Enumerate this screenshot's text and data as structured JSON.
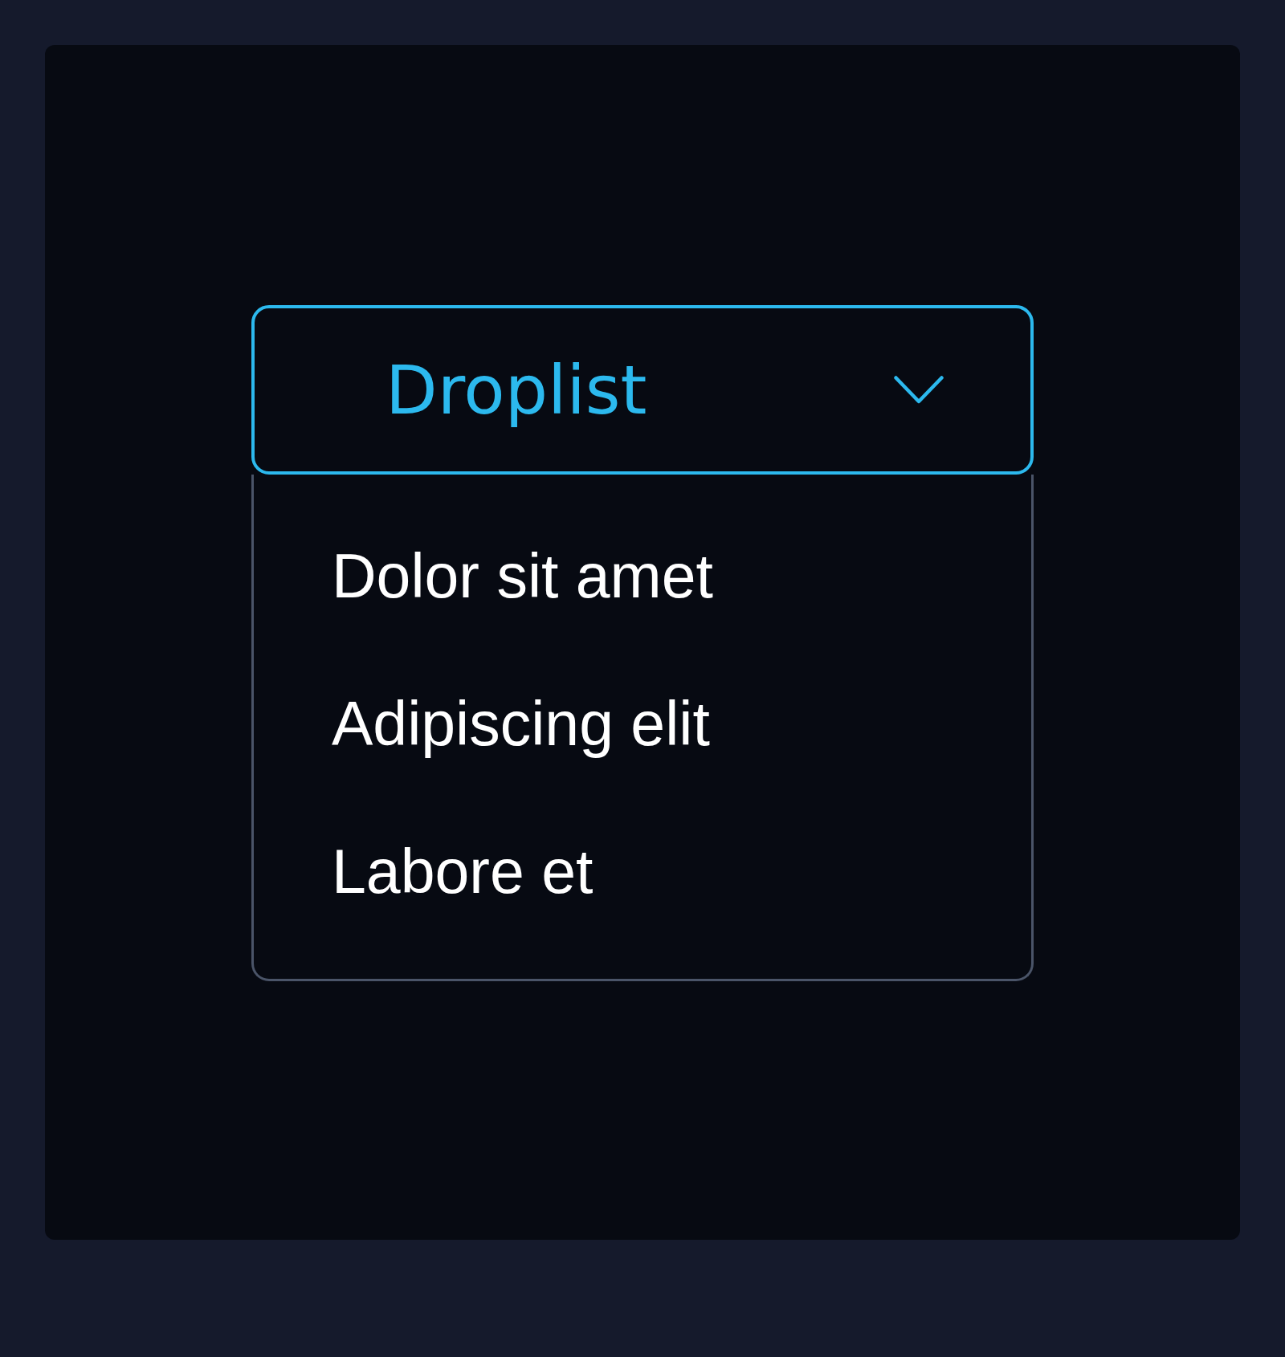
{
  "droplist": {
    "label": "Droplist",
    "expanded": true
  },
  "options": [
    {
      "label": "Dolor sit amet"
    },
    {
      "label": "Adipiscing elit"
    },
    {
      "label": "Labore et"
    }
  ]
}
